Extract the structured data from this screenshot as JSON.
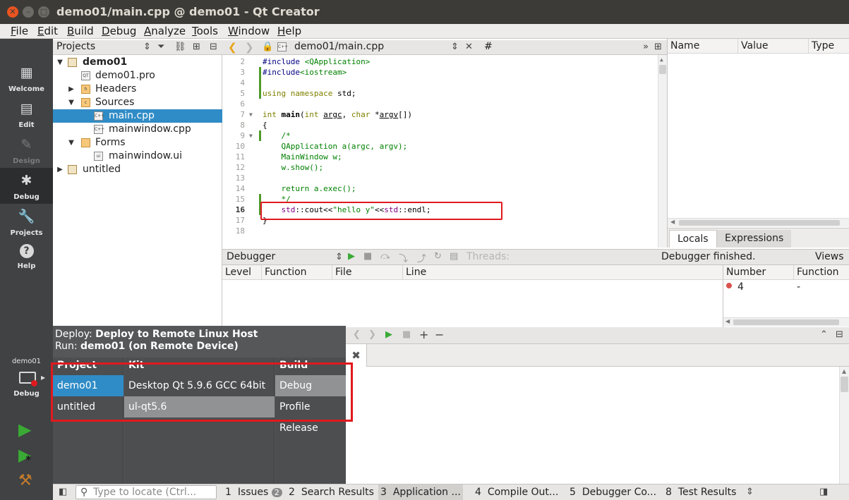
{
  "window": {
    "title": "demo01/main.cpp @ demo01 - Qt Creator"
  },
  "menu": [
    "File",
    "Edit",
    "Build",
    "Debug",
    "Analyze",
    "Tools",
    "Window",
    "Help"
  ],
  "modes": [
    {
      "label": "Welcome",
      "icon": "grid-icon"
    },
    {
      "label": "Edit",
      "icon": "document-icon"
    },
    {
      "label": "Design",
      "icon": "pencil-icon",
      "disabled": true
    },
    {
      "label": "Debug",
      "icon": "bug-icon",
      "active": true
    },
    {
      "label": "Projects",
      "icon": "wrench-icon"
    },
    {
      "label": "Help",
      "icon": "help-icon"
    }
  ],
  "target": {
    "project": "demo01",
    "mode": "Debug"
  },
  "projects": {
    "title": "Projects",
    "tree": [
      {
        "label": "demo01",
        "bold": true,
        "icon": "project-icon"
      },
      {
        "label": "demo01.pro",
        "icon": "pro-file-icon"
      },
      {
        "label": "Headers",
        "icon": "folder-icon"
      },
      {
        "label": "Sources",
        "icon": "folder-icon"
      },
      {
        "label": "main.cpp",
        "icon": "cpp-file-icon",
        "selected": true
      },
      {
        "label": "mainwindow.cpp",
        "icon": "cpp-file-icon"
      },
      {
        "label": "Forms",
        "icon": "folder-icon"
      },
      {
        "label": "mainwindow.ui",
        "icon": "ui-file-icon"
      },
      {
        "label": "untitled",
        "icon": "project-icon"
      }
    ]
  },
  "editor": {
    "filename": "demo01/main.cpp",
    "symbol": "#",
    "current_line": "16",
    "lines": [
      {
        "n": "2",
        "text": "#include <QApplication>"
      },
      {
        "n": "3",
        "text": "#include<iostream>"
      },
      {
        "n": "4",
        "text": ""
      },
      {
        "n": "5",
        "text": "using namespace std;"
      },
      {
        "n": "6",
        "text": ""
      },
      {
        "n": "7",
        "text": "int main(int argc, char *argv[])"
      },
      {
        "n": "8",
        "text": "{"
      },
      {
        "n": "9",
        "text": "    /*"
      },
      {
        "n": "10",
        "text": "    QApplication a(argc, argv);"
      },
      {
        "n": "11",
        "text": "    MainWindow w;"
      },
      {
        "n": "12",
        "text": "    w.show();"
      },
      {
        "n": "13",
        "text": ""
      },
      {
        "n": "14",
        "text": "    return a.exec();"
      },
      {
        "n": "15",
        "text": "    */"
      },
      {
        "n": "16",
        "text": "    std::cout<<\"hello y\"<<std::endl;"
      },
      {
        "n": "17",
        "text": "}"
      },
      {
        "n": "18",
        "text": ""
      }
    ]
  },
  "locals": {
    "columns": [
      "Name",
      "Value",
      "Type"
    ],
    "tabs": [
      "Locals",
      "Expressions"
    ]
  },
  "debugger": {
    "title": "Debugger",
    "threads_label": "Threads:",
    "status": "Debugger finished.",
    "views": "Views",
    "stack_columns": [
      "Level",
      "Function",
      "File",
      "Line"
    ],
    "thread_columns": [
      "Number",
      "Function"
    ],
    "thread_row": {
      "number": "4",
      "function": "-"
    }
  },
  "kit_popup": {
    "deploy_label": "Deploy:",
    "deploy_value": "Deploy to Remote Linux Host",
    "run_label": "Run:",
    "run_value": "demo01 (on Remote Device)",
    "headers": [
      "Project",
      "Kit",
      "Build"
    ],
    "projects": [
      "demo01",
      "untitled"
    ],
    "kits": [
      "Desktop Qt 5.9.6 GCC 64bit",
      "ul-qt5.6"
    ],
    "builds": [
      "Debug",
      "Profile",
      "Release"
    ]
  },
  "statusbar": {
    "locator_placeholder": "Type to locate (Ctrl...",
    "tabs": [
      {
        "num": "1",
        "label": "Issues",
        "badge": "2"
      },
      {
        "num": "2",
        "label": "Search Results"
      },
      {
        "num": "3",
        "label": "Application ..."
      },
      {
        "num": "4",
        "label": "Compile Out..."
      },
      {
        "num": "5",
        "label": "Debugger Co..."
      },
      {
        "num": "8",
        "label": "Test Results"
      }
    ]
  },
  "colors": {
    "selection": "#308cc6",
    "highlight": "#e0191e",
    "ubuntu_orange": "#e95420",
    "run_green": "#3aaa35"
  }
}
